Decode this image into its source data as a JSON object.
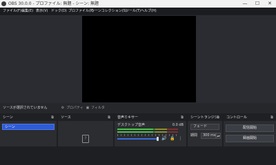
{
  "window": {
    "title": "OBS 30.0.0 - プロファイル: 無題 - シーン: 無題",
    "minimize_label": "—",
    "maximize_label": "☐",
    "close_label": "✕"
  },
  "menu": [
    "ファイル(F)",
    "編集(E)",
    "表示(V)",
    "ドック(D)",
    "プロファイル(P)",
    "シーンコレクション(S)",
    "ツール(T)",
    "ヘルプ(H)"
  ],
  "source_toolbar": {
    "status": "ソースが選択されていません",
    "properties_label": "プロパティ",
    "filters_label": "フィルタ"
  },
  "scenes": {
    "title": "シーン",
    "items": [
      "シーン"
    ]
  },
  "sources": {
    "title": "ソース",
    "empty_icon_glyph": "?"
  },
  "mixer": {
    "title": "音声ミキサー",
    "channels": [
      {
        "name": "デスクトップ音声",
        "level_db": "0.0 dB",
        "volume_fraction": 1.0
      }
    ]
  },
  "transitions": {
    "title": "シーントランジション",
    "selected": "フェード",
    "duration_label": "期間",
    "duration_value": "300 ms"
  },
  "controls": {
    "title": "コントロール",
    "buttons": [
      "配信開始",
      "録画開始"
    ]
  },
  "colors": {
    "accent": "#2f5bd3",
    "canvas": "#000000",
    "panel": "#2b2d31"
  }
}
